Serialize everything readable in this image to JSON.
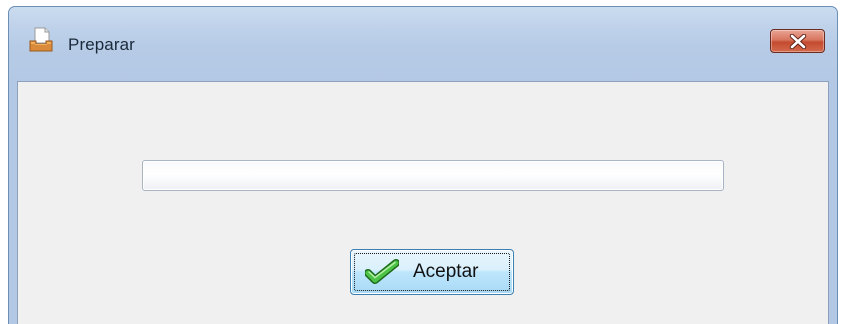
{
  "window": {
    "title": "Preparar",
    "app_icon": "document-tray-icon",
    "close_icon": "close-icon"
  },
  "progress": {
    "value": 0
  },
  "buttons": {
    "accept_label": "Aceptar",
    "accept_icon": "checkmark-icon"
  },
  "colors": {
    "titlebar": "#b9cde7",
    "client_bg": "#f0f0f0",
    "close_button": "#c94c31",
    "accept_border": "#3c7fb1",
    "checkmark": "#3aa635"
  }
}
